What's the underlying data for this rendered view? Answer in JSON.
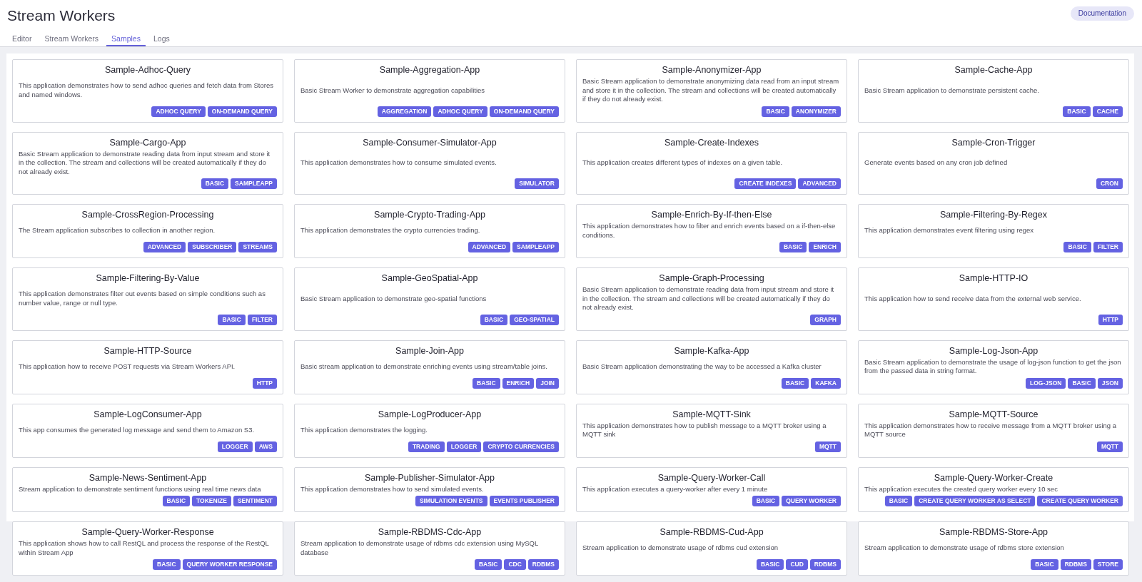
{
  "page": {
    "title": "Stream Workers",
    "documentation_button": "Documentation"
  },
  "tabs": [
    {
      "label": "Editor",
      "selected": false
    },
    {
      "label": "Stream Workers",
      "selected": false
    },
    {
      "label": "Samples",
      "selected": true
    },
    {
      "label": "Logs",
      "selected": false
    }
  ],
  "samples": [
    {
      "title": "Sample-Adhoc-Query",
      "description": "This application demonstrates how to send adhoc queries and fetch data from Stores and named windows.",
      "tags": [
        "ADHOC QUERY",
        "ON-DEMAND QUERY"
      ]
    },
    {
      "title": "Sample-Aggregation-App",
      "description": "Basic Stream Worker to demonstrate aggregation capabilities",
      "tags": [
        "AGGREGATION",
        "ADHOC QUERY",
        "ON-DEMAND QUERY"
      ]
    },
    {
      "title": "Sample-Anonymizer-App",
      "description": "Basic Stream application to demonstrate anonymizing data read from an input stream and store it in the collection. The stream and collections will be created automatically if they do not already exist.",
      "tags": [
        "BASIC",
        "ANONYMIZER"
      ]
    },
    {
      "title": "Sample-Cache-App",
      "description": "Basic Stream application to demonstrate persistent cache.",
      "tags": [
        "BASIC",
        "CACHE"
      ]
    },
    {
      "title": "Sample-Cargo-App",
      "description": "Basic Stream application to demonstrate reading data from input stream and store it in the collection. The stream and collections will be created automatically if they do not already exist.",
      "tags": [
        "BASIC",
        "SAMPLEAPP"
      ]
    },
    {
      "title": "Sample-Consumer-Simulator-App",
      "description": "This application demonstrates how to consume simulated events.",
      "tags": [
        "SIMULATOR"
      ]
    },
    {
      "title": "Sample-Create-Indexes",
      "description": "This application creates different types of indexes on a given table.",
      "tags": [
        "CREATE INDEXES",
        "ADVANCED"
      ]
    },
    {
      "title": "Sample-Cron-Trigger",
      "description": "Generate events based on any cron job defined",
      "tags": [
        "CRON"
      ]
    },
    {
      "title": "Sample-CrossRegion-Processing",
      "description": "The Stream application subscribes to collection in another region.",
      "tags": [
        "ADVANCED",
        "SUBSCRIBER",
        "STREAMS"
      ]
    },
    {
      "title": "Sample-Crypto-Trading-App",
      "description": "This application demonstrates the crypto currencies trading.",
      "tags": [
        "ADVANCED",
        "SAMPLEAPP"
      ]
    },
    {
      "title": "Sample-Enrich-By-If-then-Else",
      "description": "This application demonstrates how to filter and enrich events based on a if-then-else conditions.",
      "tags": [
        "BASIC",
        "ENRICH"
      ]
    },
    {
      "title": "Sample-Filtering-By-Regex",
      "description": "This application demonstrates event filtering using regex",
      "tags": [
        "BASIC",
        "FILTER"
      ]
    },
    {
      "title": "Sample-Filtering-By-Value",
      "description": "This application demonstrates filter out events based on simple conditions such as number value, range or null type.",
      "tags": [
        "BASIC",
        "FILTER"
      ]
    },
    {
      "title": "Sample-GeoSpatial-App",
      "description": "Basic Stream application to demonstrate geo-spatial functions",
      "tags": [
        "BASIC",
        "GEO-SPATIAL"
      ]
    },
    {
      "title": "Sample-Graph-Processing",
      "description": "Basic Stream application to demonstrate reading data from input stream and store it in the collection. The stream and collections will be created automatically if they do not already exist.",
      "tags": [
        "GRAPH"
      ]
    },
    {
      "title": "Sample-HTTP-IO",
      "description": "This application how to send receive data from the external web service.",
      "tags": [
        "HTTP"
      ]
    },
    {
      "title": "Sample-HTTP-Source",
      "description": "This application how to receive POST requests via Stream Workers API.",
      "tags": [
        "HTTP"
      ]
    },
    {
      "title": "Sample-Join-App",
      "description": "Basic stream application to demonstrate enriching events using stream/table joins.",
      "tags": [
        "BASIC",
        "ENRICH",
        "JOIN"
      ]
    },
    {
      "title": "Sample-Kafka-App",
      "description": "Basic Stream application demonstrating the way to be accessed a Kafka cluster",
      "tags": [
        "BASIC",
        "KAFKA"
      ]
    },
    {
      "title": "Sample-Log-Json-App",
      "description": "Basic Stream application to demonstrate the usage of log-json function to get the json from the passed data in string format.",
      "tags": [
        "LOG-JSON",
        "BASIC",
        "JSON"
      ]
    },
    {
      "title": "Sample-LogConsumer-App",
      "description": "This app consumes the generated log message and send them to Amazon S3.",
      "tags": [
        "LOGGER",
        "AWS"
      ]
    },
    {
      "title": "Sample-LogProducer-App",
      "description": "This application demonstrates the logging.",
      "tags": [
        "TRADING",
        "LOGGER",
        "CRYPTO CURRENCIES"
      ]
    },
    {
      "title": "Sample-MQTT-Sink",
      "description": "This application demonstrates how to publish message to a MQTT broker using a MQTT sink",
      "tags": [
        "MQTT"
      ]
    },
    {
      "title": "Sample-MQTT-Source",
      "description": "This application demonstrates how to receive message from a MQTT broker using a MQTT source",
      "tags": [
        "MQTT"
      ]
    },
    {
      "title": "Sample-News-Sentiment-App",
      "description": "Stream application to demonstrate sentiment functions using real time news data",
      "tags": [
        "BASIC",
        "TOKENIZE",
        "SENTIMENT"
      ]
    },
    {
      "title": "Sample-Publisher-Simulator-App",
      "description": "This application demonstrates how to send simulated events.",
      "tags": [
        "SIMULATION EVENTS",
        "EVENTS PUBLISHER"
      ]
    },
    {
      "title": "Sample-Query-Worker-Call",
      "description": "This application executes a query-worker after every 1 minute",
      "tags": [
        "BASIC",
        "QUERY WORKER"
      ]
    },
    {
      "title": "Sample-Query-Worker-Create",
      "description": "This application executes the created query worker every 10 sec",
      "tags": [
        "BASIC",
        "CREATE QUERY WORKER AS SELECT",
        "CREATE QUERY WORKER"
      ]
    },
    {
      "title": "Sample-Query-Worker-Response",
      "description": "This application shows how to call RestQL and process the response of the RestQL within Stream App",
      "tags": [
        "BASIC",
        "QUERY WORKER RESPONSE"
      ]
    },
    {
      "title": "Sample-RBDMS-Cdc-App",
      "description": "Stream application to demonstrate usage of rdbms cdc extension using MySQL database",
      "tags": [
        "BASIC",
        "CDC",
        "RDBMS"
      ]
    },
    {
      "title": "Sample-RBDMS-Cud-App",
      "description": "Stream application to demonstrate usage of rdbms cud extension",
      "tags": [
        "BASIC",
        "CUD",
        "RDBMS"
      ]
    },
    {
      "title": "Sample-RBDMS-Store-App",
      "description": "Stream application to demonstrate usage of rdbms store extension",
      "tags": [
        "BASIC",
        "RDBMS",
        "STORE"
      ]
    }
  ]
}
